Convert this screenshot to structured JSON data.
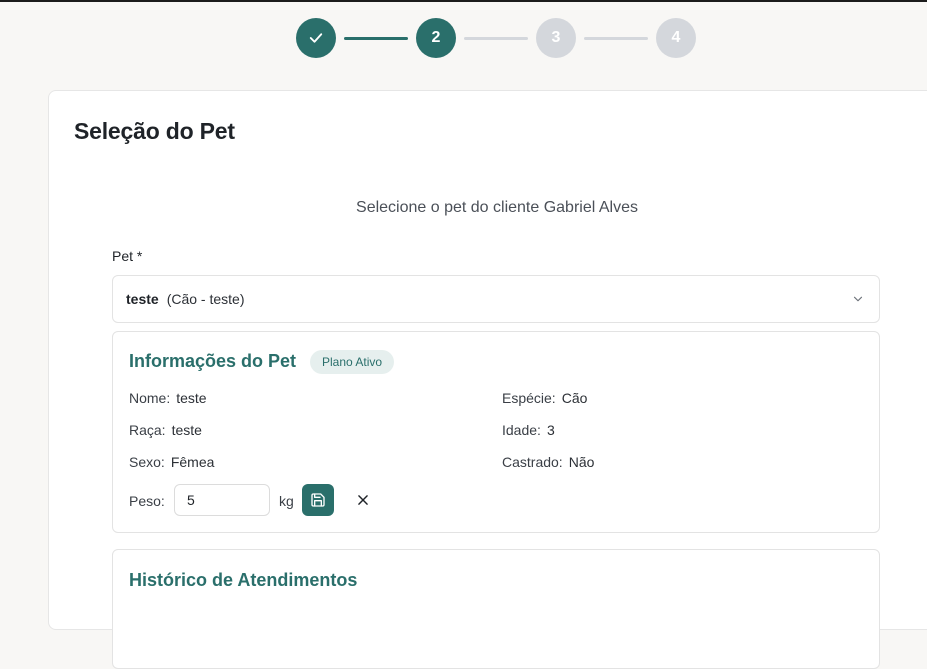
{
  "colors": {
    "accent": "#2a6f6b",
    "inactive_step": "#d4d7dc",
    "badge_bg": "#e6efee"
  },
  "stepper": {
    "steps": [
      {
        "label": "",
        "state": "done",
        "icon": "check-icon"
      },
      {
        "label": "2",
        "state": "active"
      },
      {
        "label": "3",
        "state": "todo"
      },
      {
        "label": "4",
        "state": "todo"
      }
    ]
  },
  "page": {
    "title": "Seleção do Pet",
    "subtitle": "Selecione o pet do cliente Gabriel Alves"
  },
  "pet_select": {
    "label": "Pet *",
    "selected_name": "teste",
    "selected_detail": "(Cão - teste)",
    "icon": "chevron-down-icon"
  },
  "pet_info": {
    "title": "Informações do Pet",
    "badge": "Plano Ativo",
    "fields": {
      "nome": {
        "label": "Nome:",
        "value": "teste"
      },
      "especie": {
        "label": "Espécie:",
        "value": "Cão"
      },
      "raca": {
        "label": "Raça:",
        "value": "teste"
      },
      "idade": {
        "label": "Idade:",
        "value": "3"
      },
      "sexo": {
        "label": "Sexo:",
        "value": "Fêmea"
      },
      "castrado": {
        "label": "Castrado:",
        "value": "Não"
      }
    },
    "peso": {
      "label": "Peso:",
      "value": "5",
      "unit": "kg",
      "save_icon": "save-icon",
      "cancel_icon": "close-icon"
    }
  },
  "history": {
    "title": "Histórico de Atendimentos"
  }
}
